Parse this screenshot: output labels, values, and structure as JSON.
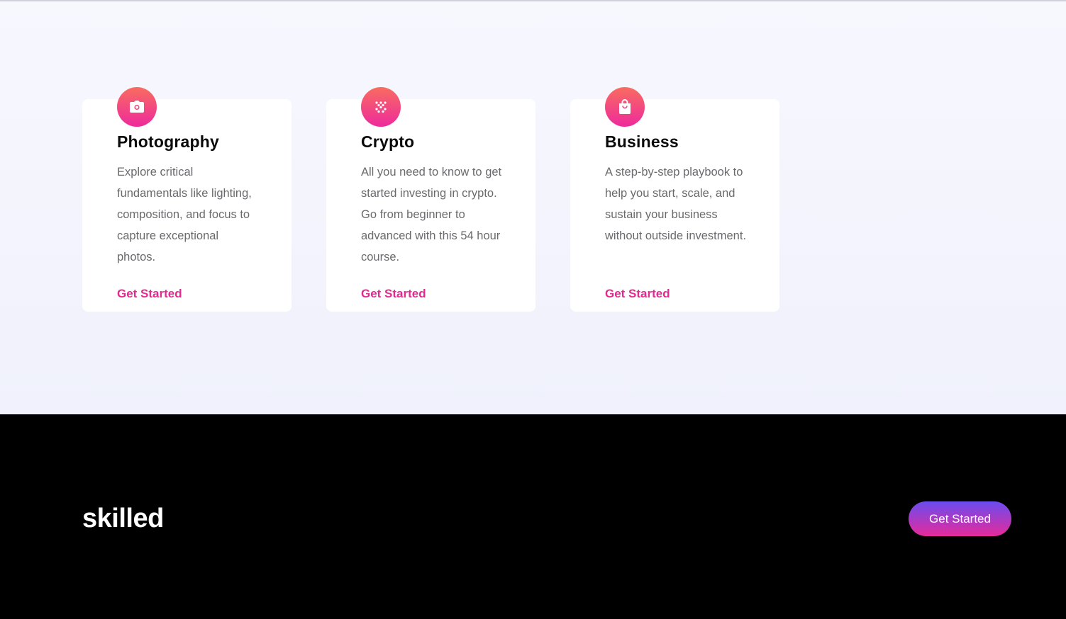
{
  "colors": {
    "accent_pink": "#e32a92",
    "icon_gradient_start": "#f86c60",
    "icon_gradient_end": "#ee2a9c",
    "cta_gradient_start": "#6a4cf0",
    "cta_gradient_end": "#e72a9a",
    "section_bg": "#f4f4fd",
    "footer_bg": "#000000"
  },
  "cards": [
    {
      "icon": "camera-icon",
      "title": "Photography",
      "description": "Explore critical fundamentals like lighting, composition, and focus to capture exceptional photos.",
      "link_label": "Get Started"
    },
    {
      "icon": "crypto-icon",
      "title": "Crypto",
      "description": "All you need to know to get started investing in crypto. Go from beginner to advanced with this 54 hour course.",
      "link_label": "Get Started"
    },
    {
      "icon": "shopping-bag-icon",
      "title": "Business",
      "description": "A step-by-step playbook to help you start, scale, and sustain your business without outside investment.",
      "link_label": "Get Started"
    }
  ],
  "footer": {
    "logo": "skilled",
    "cta_label": "Get Started"
  }
}
